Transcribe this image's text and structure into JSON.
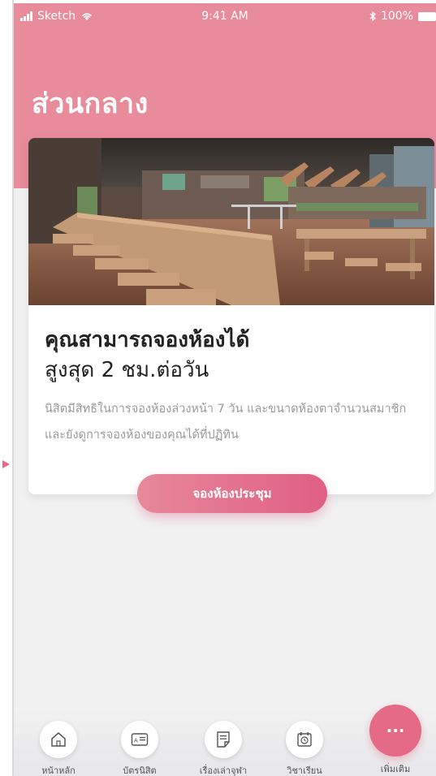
{
  "status_bar": {
    "carrier": "Sketch",
    "time": "9:41 AM",
    "battery": "100%"
  },
  "page": {
    "title": "ส่วนกลาง"
  },
  "card": {
    "heading_line1": "คุณสามารถจองห้องได้",
    "heading_line2": "สูงสุด 2 ชม.ต่อวัน",
    "description": "นิสิตมีสิทธิในการจองห้องล่วงหน้า 7 วัน และขนาดห้องตาจำนวนสมาชิก และยังดูการจองห้องของคุณได้ที่ปฏิทิน"
  },
  "cta": {
    "label": "จองห้องประชุม"
  },
  "bottom_nav": {
    "items": [
      {
        "label": "หน้าหลัก",
        "icon": "home-icon"
      },
      {
        "label": "บัตรนิสิต",
        "icon": "id-card-icon"
      },
      {
        "label": "เรื่องเล่าจุฬา",
        "icon": "notes-icon"
      },
      {
        "label": "วิชาเรียน",
        "icon": "calendar-clock-icon"
      }
    ],
    "more": {
      "label": "เพิ่มเติม",
      "icon": "more-dots-icon",
      "glyph": "···"
    }
  },
  "colors": {
    "brand_pink": "#e88b9b",
    "accent_pink": "#e46a86"
  }
}
